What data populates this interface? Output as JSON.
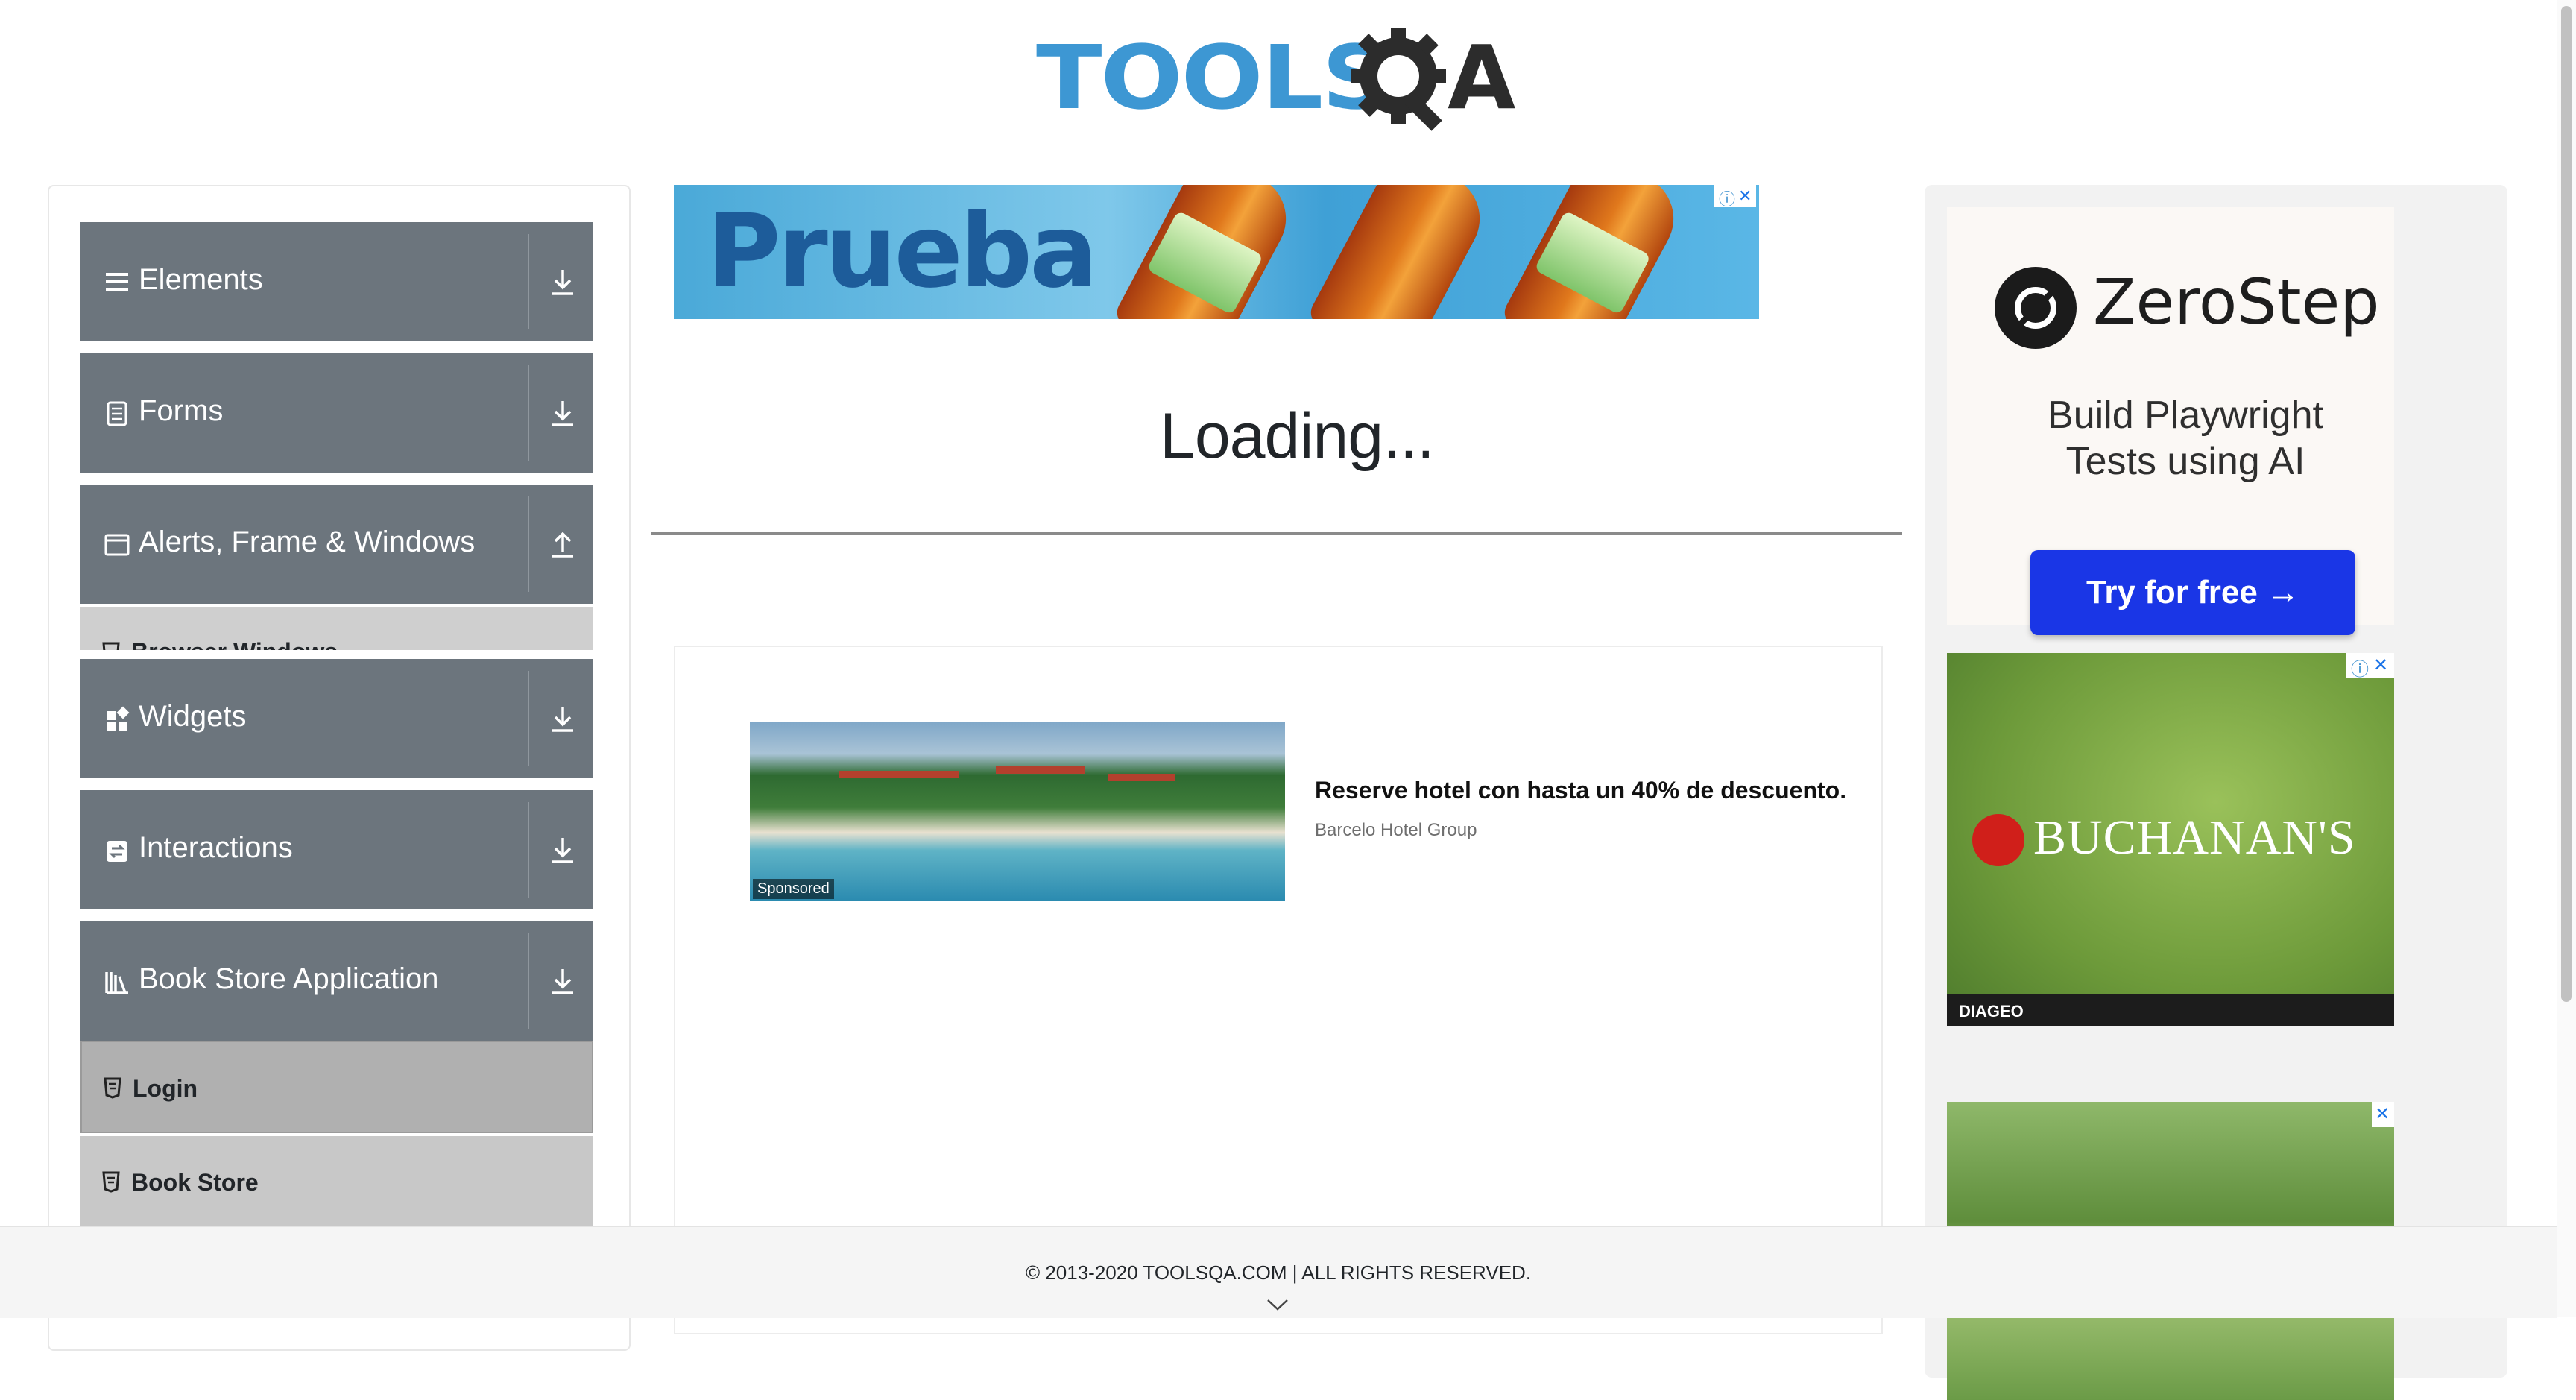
{
  "logo": {
    "text_main": "TOOLS",
    "text_end": "A"
  },
  "sidebar": {
    "groups": [
      {
        "label": "Elements",
        "icon": "hamburger-icon",
        "arrow": "download-arrow-icon"
      },
      {
        "label": "Forms",
        "icon": "document-icon",
        "arrow": "download-arrow-icon"
      },
      {
        "label": "Alerts, Frame & Windows",
        "icon": "window-icon",
        "arrow": "upload-arrow-icon"
      },
      {
        "label": "Widgets",
        "icon": "widgets-icon",
        "arrow": "download-arrow-icon"
      },
      {
        "label": "Interactions",
        "icon": "interactions-icon",
        "arrow": "download-arrow-icon"
      },
      {
        "label": "Book Store Application",
        "icon": "library-icon",
        "arrow": "download-arrow-icon"
      }
    ],
    "partial_item": "Browser Windows",
    "book_items": [
      "Login",
      "Book Store"
    ]
  },
  "top_ad": {
    "text": "Prueba"
  },
  "main": {
    "loading_text": "Loading..."
  },
  "native_ad": {
    "badge": "Sponsored",
    "headline": "Reserve hotel con hasta un 40% de descuento.",
    "source": "Barcelo Hotel Group"
  },
  "right_ads": {
    "zerostep_name": "ZeroStep",
    "zerostep_tagline_1": "Build Playwright",
    "zerostep_tagline_2": "Tests using AI",
    "zerostep_button": "Try for free →",
    "buchanans": "BUCHANAN'S",
    "diageo": "DIAGEO"
  },
  "footer": {
    "copyright": "© 2013-2020 TOOLSQA.COM | ALL RIGHTS RESERVED."
  },
  "colors": {
    "sidebar_header": "#6c757d",
    "logo_blue": "#3d97d3",
    "zerostep_button": "#1a36e6"
  }
}
